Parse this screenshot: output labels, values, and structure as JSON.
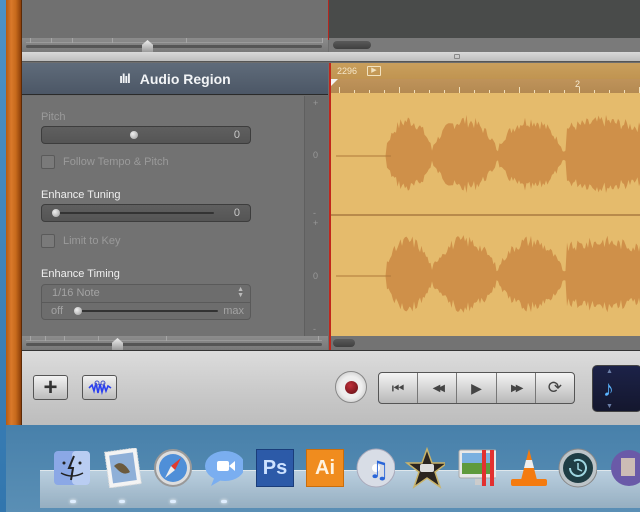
{
  "editor": {
    "header": {
      "title": "Audio Region",
      "icon": "waveform-icon"
    },
    "pitch": {
      "label": "Pitch",
      "value": "0",
      "position": 0.5
    },
    "follow_tempo": {
      "label": "Follow Tempo & Pitch",
      "checked": false
    },
    "enhance_tuning": {
      "label": "Enhance Tuning",
      "value": "0",
      "position": 0.0
    },
    "limit_to_key": {
      "label": "Limit to Key",
      "checked": false
    },
    "enhance_timing": {
      "label": "Enhance Timing",
      "selected": "1/16 Note",
      "min_label": "off",
      "max_label": "max",
      "position": 0.0
    },
    "vscale": {
      "top_labels": [
        "+",
        "0",
        "-"
      ],
      "bottom_labels": [
        "+",
        "0",
        "-"
      ]
    }
  },
  "timeline": {
    "tempo_text": "2296",
    "flag_icon": "play-flag-icon",
    "bar_numbers": [
      "2"
    ]
  },
  "controlbar": {
    "add_track": "+",
    "edit_button_icon": "scissors-waveform-icon",
    "record_icon": "record-icon",
    "transport": [
      {
        "name": "go-to-beginning",
        "glyph": "⏮"
      },
      {
        "name": "rewind",
        "glyph": "◀◀"
      },
      {
        "name": "play",
        "glyph": "▶"
      },
      {
        "name": "fast-forward",
        "glyph": "▶▶"
      },
      {
        "name": "cycle",
        "glyph": "⟳"
      }
    ],
    "lcd": {
      "mode_icon": "music-note-icon",
      "glyph": "♪",
      "up": "▲",
      "down": "▼"
    }
  },
  "dock": {
    "items": [
      {
        "name": "finder",
        "label": "Finder",
        "running": true
      },
      {
        "name": "mail",
        "label": "Mail",
        "running": true
      },
      {
        "name": "safari",
        "label": "Safari",
        "running": true
      },
      {
        "name": "ichat",
        "label": "iChat",
        "running": true
      },
      {
        "name": "photoshop",
        "label": "Ps",
        "running": false
      },
      {
        "name": "illustrator",
        "label": "Ai",
        "running": false
      },
      {
        "name": "itunes",
        "label": "iTunes",
        "running": false
      },
      {
        "name": "imovie",
        "label": "iMovie",
        "running": false
      },
      {
        "name": "parallels",
        "label": "Parallels",
        "running": false
      },
      {
        "name": "vlc",
        "label": "VLC",
        "running": false
      },
      {
        "name": "time-machine",
        "label": "Time Machine",
        "running": false
      },
      {
        "name": "system-app",
        "label": "App",
        "running": false
      }
    ]
  }
}
